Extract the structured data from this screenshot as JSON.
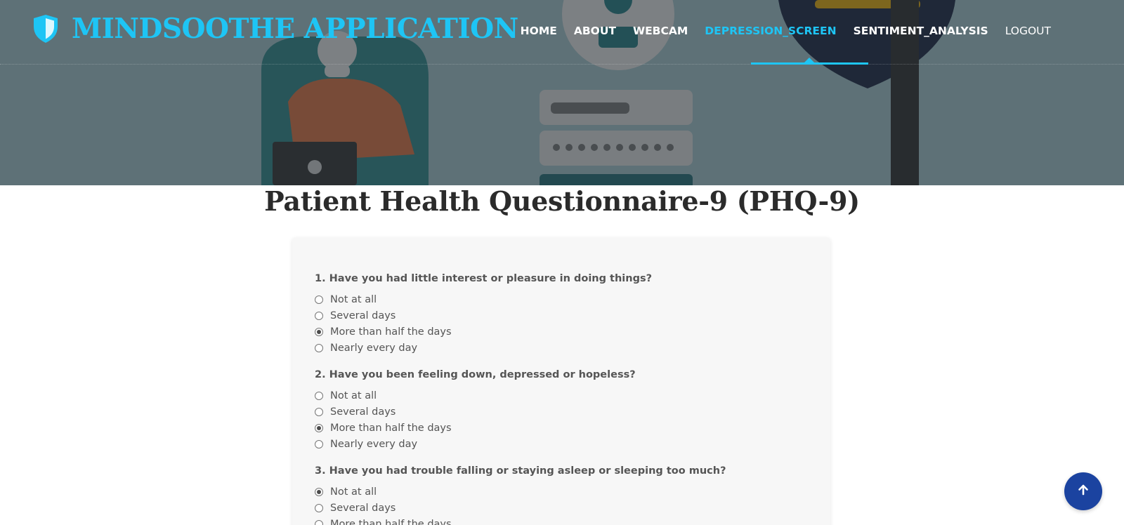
{
  "app": {
    "title": "MINDSOOTHE APPLICATION",
    "logo_icon": "shield-icon",
    "accent_color": "#1ec5f5"
  },
  "nav": {
    "items": [
      {
        "label": "HOME"
      },
      {
        "label": "ABOUT"
      },
      {
        "label": "WEBCAM"
      },
      {
        "label": "DEPRESSION_SCREEN"
      },
      {
        "label": "SENTIMENT_ANALYSIS"
      },
      {
        "label": "LOGOUT"
      }
    ],
    "active": "DEPRESSION_SCREEN"
  },
  "page": {
    "title": "Patient Health Questionnaire-9 (PHQ-9)"
  },
  "questions": [
    {
      "text": "1. Have you had little interest or pleasure in doing things?",
      "options": [
        "Not at all",
        "Several days",
        "More than half the days",
        "Nearly every day"
      ],
      "selected": "More than half the days"
    },
    {
      "text": "2. Have you been feeling down, depressed or hopeless?",
      "options": [
        "Not at all",
        "Several days",
        "More than half the days",
        "Nearly every day"
      ],
      "selected": "More than half the days"
    },
    {
      "text": "3. Have you had trouble falling or staying asleep or sleeping too much?",
      "options": [
        "Not at all",
        "Several days",
        "More than half the days"
      ],
      "selected": "Not at all"
    }
  ],
  "back_to_top": {
    "icon": "arrow-up-icon",
    "color": "#1b43a0"
  }
}
